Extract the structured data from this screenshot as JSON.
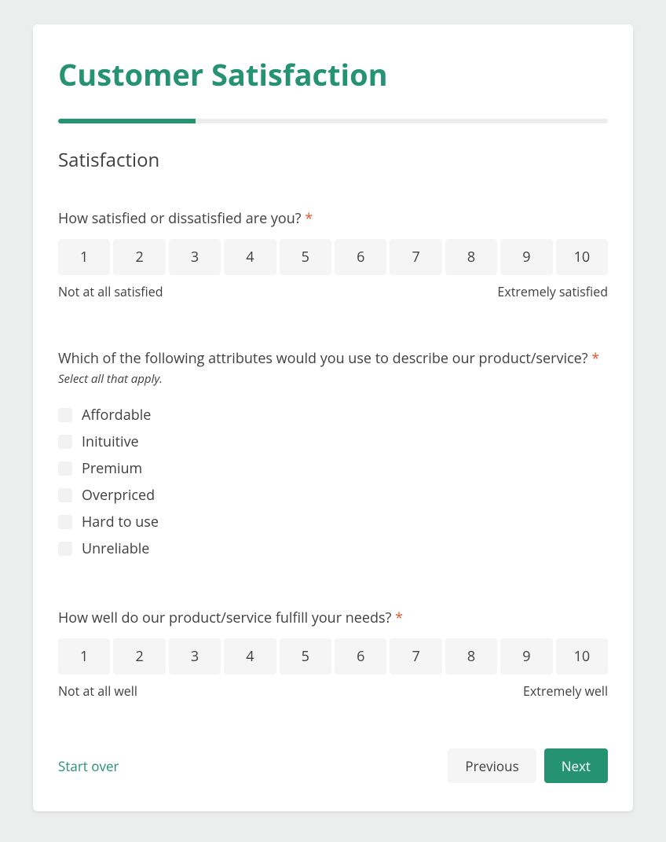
{
  "title": "Customer Satisfaction",
  "progress_percent": 25,
  "section": "Satisfaction",
  "q1": {
    "label": "How satisfied or dissatisfied are you?",
    "required": "*",
    "scale": [
      "1",
      "2",
      "3",
      "4",
      "5",
      "6",
      "7",
      "8",
      "9",
      "10"
    ],
    "anchor_low": "Not at all satisfied",
    "anchor_high": "Extremely satisfied"
  },
  "q2": {
    "label": "Which of the following attributes would you use to describe our product/service?",
    "required": "*",
    "hint": "Select all that apply.",
    "options": [
      "Affordable",
      "Inituitive",
      "Premium",
      "Overpriced",
      "Hard to use",
      "Unreliable"
    ]
  },
  "q3": {
    "label": "How well do our product/service fulfill your needs?",
    "required": "*",
    "scale": [
      "1",
      "2",
      "3",
      "4",
      "5",
      "6",
      "7",
      "8",
      "9",
      "10"
    ],
    "anchor_low": "Not at all well",
    "anchor_high": "Extremely well"
  },
  "footer": {
    "start_over": "Start over",
    "previous": "Previous",
    "next": "Next"
  }
}
